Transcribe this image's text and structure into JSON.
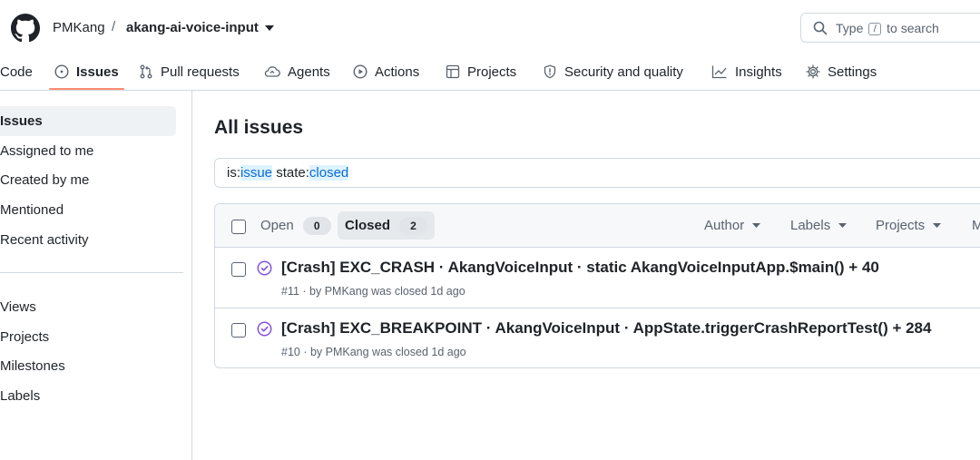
{
  "header": {
    "owner": "PMKang",
    "separator": "/",
    "repo": "akang-ai-voice-input",
    "search_prefix": "Type",
    "search_key": "/",
    "search_suffix": "to search"
  },
  "tabs": [
    {
      "label": "Code",
      "icon": "code-icon"
    },
    {
      "label": "Issues",
      "icon": "issue-opened-icon",
      "active": true
    },
    {
      "label": "Pull requests",
      "icon": "git-pull-request-icon"
    },
    {
      "label": "Agents",
      "icon": "agent-cloud-icon"
    },
    {
      "label": "Actions",
      "icon": "play-icon"
    },
    {
      "label": "Projects",
      "icon": "table-icon"
    },
    {
      "label": "Security and quality",
      "icon": "shield-icon"
    },
    {
      "label": "Insights",
      "icon": "graph-icon"
    },
    {
      "label": "Settings",
      "icon": "gear-icon"
    }
  ],
  "sidebar": {
    "items": [
      {
        "label": "Issues",
        "active": true
      },
      {
        "label": "Assigned to me"
      },
      {
        "label": "Created by me"
      },
      {
        "label": "Mentioned"
      },
      {
        "label": "Recent activity"
      }
    ],
    "items2": [
      {
        "label": "Views"
      },
      {
        "label": "Projects"
      },
      {
        "label": "Milestones"
      },
      {
        "label": "Labels"
      }
    ]
  },
  "main": {
    "title": "All issues",
    "query": {
      "k1": "is:",
      "v1": "issue",
      "k2": " state:",
      "v2": "closed"
    },
    "states": {
      "open_label": "Open",
      "open_count": "0",
      "closed_label": "Closed",
      "closed_count": "2"
    },
    "filters": [
      "Author",
      "Labels",
      "Projects",
      "M"
    ],
    "issues": [
      {
        "title": "[Crash] EXC_CRASH · AkangVoiceInput · static AkangVoiceInputApp.$main() + 40",
        "meta": "#11 · by PMKang was closed 1d ago"
      },
      {
        "title": "[Crash] EXC_BREAKPOINT · AkangVoiceInput · AppState.triggerCrashReportTest() + 284",
        "meta": "#10 · by PMKang was closed 1d ago"
      }
    ]
  },
  "colors": {
    "accent_underline": "#fd8c73",
    "closed_purple": "#8250df",
    "link_blue": "#0969da"
  }
}
